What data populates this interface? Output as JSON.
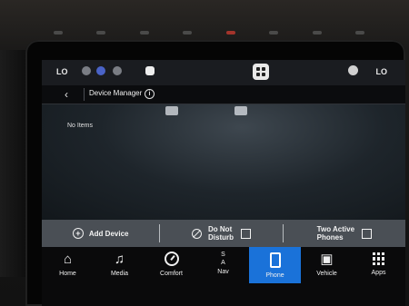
{
  "status_bar": {
    "temp_left": "LO",
    "temp_right": "LO",
    "icons": [
      "seat-heat-icon",
      "profile-icon",
      "app-grid-icon",
      "user-icon"
    ]
  },
  "header": {
    "title": "Device Manager",
    "back_icon": "chevron-left-icon",
    "info_icon": "info-icon"
  },
  "main": {
    "empty_text": "No Items"
  },
  "actions": {
    "add_device": "Add Device",
    "do_not_disturb_line1": "Do Not",
    "do_not_disturb_line2": "Disturb",
    "do_not_disturb_checked": false,
    "two_active_line1": "Two Active",
    "two_active_line2": "Phones",
    "two_active_checked": false
  },
  "nav": {
    "home": "Home",
    "media": "Media",
    "comfort": "Comfort",
    "nav_letter_top": "S",
    "nav_letter_mid": "A",
    "nav": "Nav",
    "phone": "Phone",
    "vehicle": "Vehicle",
    "apps": "Apps",
    "active": "Phone"
  },
  "colors": {
    "accent": "#1a72d9",
    "action_bar": "#4a4f55",
    "hardware_red": "#c43a2f"
  }
}
